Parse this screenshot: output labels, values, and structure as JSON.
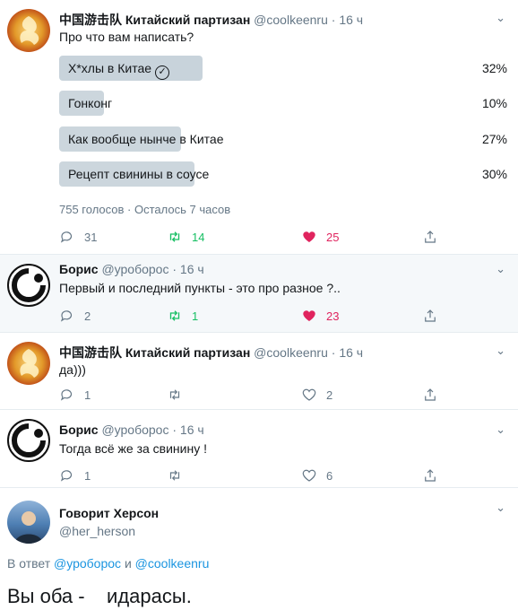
{
  "thread": [
    {
      "name": "中国游击队 Китайский партизан",
      "handle": "@coolkeenru",
      "time": "16 ч",
      "text": "Про что вам написать?",
      "poll": {
        "options": [
          {
            "label": "Х*хлы в Китае",
            "percent": "32%",
            "fraction": 0.32,
            "winner": true
          },
          {
            "label": "Гонконг",
            "percent": "10%",
            "fraction": 0.1,
            "winner": false
          },
          {
            "label": "Как вообще нынче в Китае",
            "percent": "27%",
            "fraction": 0.27,
            "winner": false
          },
          {
            "label": "Рецепт свинины в соусе",
            "percent": "30%",
            "fraction": 0.3,
            "winner": false
          }
        ],
        "meta": "755 голосов · Осталось 7 часов"
      },
      "replies": "31",
      "retweets": "14",
      "likes": "25"
    },
    {
      "name": "Борис",
      "handle": "@уробор​ос",
      "time": "16 ч",
      "text": "Первый и последний пункты - это про разное ?..",
      "replies": "2",
      "retweets": "1",
      "likes": "23"
    },
    {
      "name": "中国游击队 Китайский партизан",
      "handle": "@coolkeenru",
      "time": "16 ч",
      "text": "да)))",
      "replies": "1",
      "retweets": "",
      "likes": "2"
    },
    {
      "name": "Борис",
      "handle": "@уробор​ос",
      "time": "16 ч",
      "text": "Тогда всё же за свинину !",
      "replies": "1",
      "retweets": "",
      "likes": "6"
    }
  ],
  "focused": {
    "name": "Говорит Херсон",
    "handle": "@her_herson",
    "replying_prefix": "В ответ",
    "replying_to_1": "@уробор​ос",
    "replying_and": "и",
    "replying_to_2": "@coolkeenru",
    "text": "Вы оба -    идарасы."
  },
  "colors": {
    "accent": "#1b95e0",
    "retweet_active": "#17bf63",
    "like_active": "#e0245e",
    "muted": "#657786",
    "poll_bar": "#ccd6dd"
  }
}
